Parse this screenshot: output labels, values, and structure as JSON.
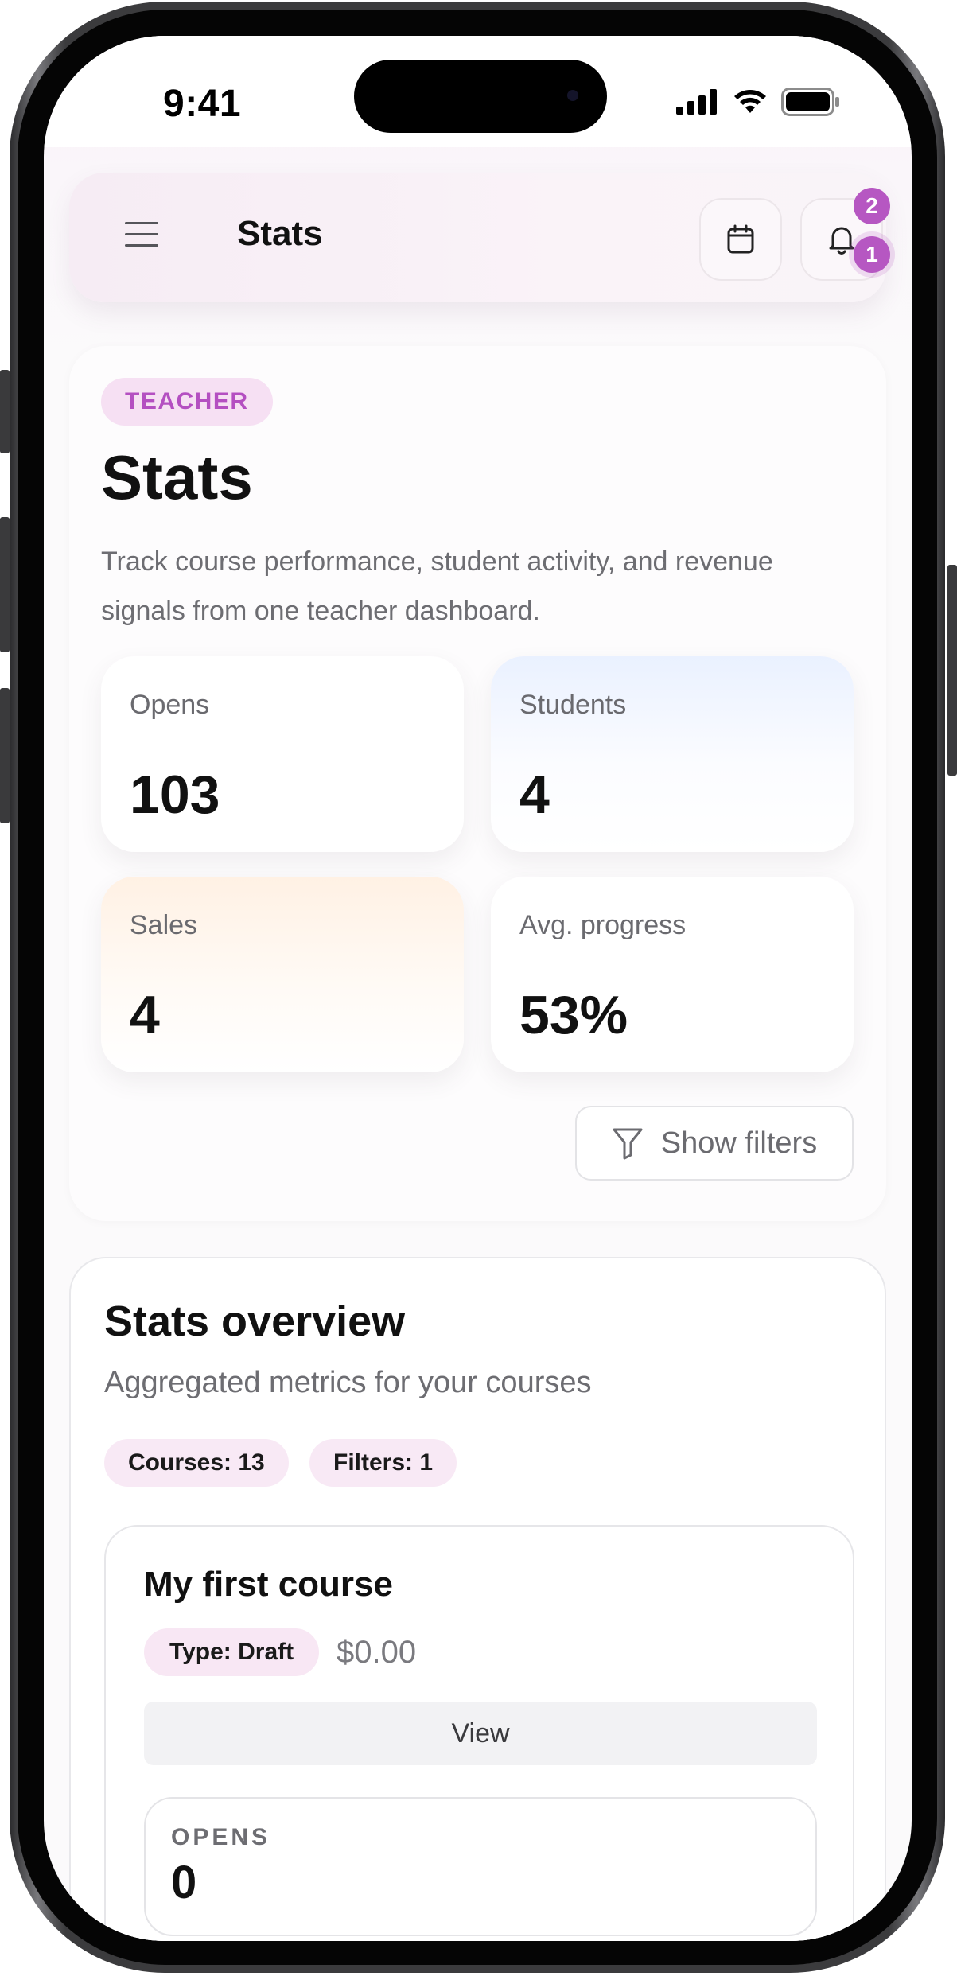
{
  "status_bar": {
    "time": "9:41"
  },
  "top_bar": {
    "title": "Stats",
    "notification_badges": [
      "2",
      "1"
    ]
  },
  "hero": {
    "role_chip": "TEACHER",
    "title": "Stats",
    "description": "Track course performance, student activity, and revenue signals from one teacher dashboard.",
    "stats": [
      {
        "label": "Opens",
        "value": "103"
      },
      {
        "label": "Students",
        "value": "4"
      },
      {
        "label": "Sales",
        "value": "4"
      },
      {
        "label": "Avg. progress",
        "value": "53%"
      }
    ],
    "filters_button": "Show filters"
  },
  "overview": {
    "title": "Stats overview",
    "subtitle": "Aggregated metrics for your courses",
    "pills": [
      "Courses: 13",
      "Filters: 1"
    ],
    "course": {
      "title": "My first course",
      "type_chip": "Type: Draft",
      "price": "$0.00",
      "view_button": "View",
      "opens_label": "OPENS",
      "opens_value": "0"
    }
  },
  "icons": {
    "menu": "hamburger-menu-icon",
    "calendar": "calendar-icon",
    "notifications": "bell-icon",
    "filter": "funnel-icon"
  },
  "colors": {
    "accent": "#b657c2",
    "chip_bg": "#f6e0f3"
  }
}
